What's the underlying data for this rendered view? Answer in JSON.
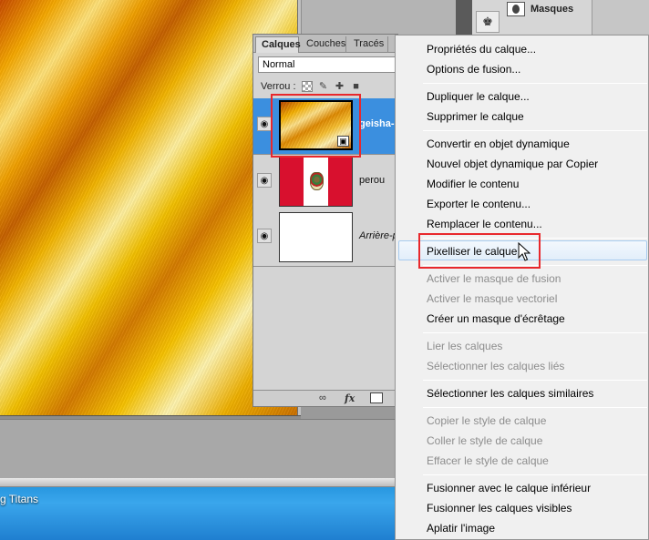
{
  "colors": {
    "selection_blue": "#3b8fdf",
    "highlight_red": "#e8282c",
    "menu_bg": "#f0f0f0",
    "disabled_text": "#8d8d8d",
    "desktop_blue": "#1d8fd9"
  },
  "top_panel": {
    "masques_label": "Masques",
    "stamp_icon": "stamp-icon"
  },
  "layers_panel": {
    "tabs": [
      {
        "label": "Calques",
        "active": true
      },
      {
        "label": "Couches",
        "active": false
      },
      {
        "label": "Tracés",
        "active": false
      }
    ],
    "blend_mode": "Normal",
    "lock_label": "Verrou :",
    "layers": [
      {
        "name": "geisha-o",
        "selected": true,
        "visible": true,
        "thumbnail": "gold-silk",
        "smart_object": true
      },
      {
        "name": "perou",
        "selected": false,
        "visible": true,
        "thumbnail": "peru-flag",
        "smart_object": false
      },
      {
        "name": "Arrière-p",
        "selected": false,
        "visible": true,
        "thumbnail": "white",
        "smart_object": false
      }
    ],
    "footer_icons": [
      "link-icon",
      "fx-icon",
      "add-mask-icon"
    ],
    "footer_fx": "fx"
  },
  "context_menu": {
    "items": [
      {
        "label": "Propriétés du calque...",
        "enabled": true
      },
      {
        "label": "Options de fusion...",
        "enabled": true
      },
      {
        "label": "Dupliquer le calque...",
        "enabled": true
      },
      {
        "label": "Supprimer le calque",
        "enabled": true
      },
      {
        "label": "Convertir en objet dynamique",
        "enabled": true
      },
      {
        "label": "Nouvel objet dynamique par Copier",
        "enabled": true
      },
      {
        "label": "Modifier le contenu",
        "enabled": true
      },
      {
        "label": "Exporter le contenu...",
        "enabled": true
      },
      {
        "label": "Remplacer le contenu...",
        "enabled": true
      },
      {
        "label": "Pixelliser le calque",
        "enabled": true,
        "hovered": true
      },
      {
        "label": "Activer le masque de fusion",
        "enabled": false
      },
      {
        "label": "Activer le masque vectoriel",
        "enabled": false
      },
      {
        "label": "Créer un masque d'écrêtage",
        "enabled": true
      },
      {
        "label": "Lier les calques",
        "enabled": false
      },
      {
        "label": "Sélectionner les calques liés",
        "enabled": false
      },
      {
        "label": "Sélectionner les calques similaires",
        "enabled": true
      },
      {
        "label": "Copier le style de calque",
        "enabled": false
      },
      {
        "label": "Coller le style de calque",
        "enabled": false
      },
      {
        "label": "Effacer le style de calque",
        "enabled": false
      },
      {
        "label": "Fusionner avec le calque inférieur",
        "enabled": true
      },
      {
        "label": "Fusionner les calques visibles",
        "enabled": true
      },
      {
        "label": "Aplatir l'image",
        "enabled": true
      }
    ]
  },
  "desktop": {
    "taskbar_label": "g Titans"
  }
}
